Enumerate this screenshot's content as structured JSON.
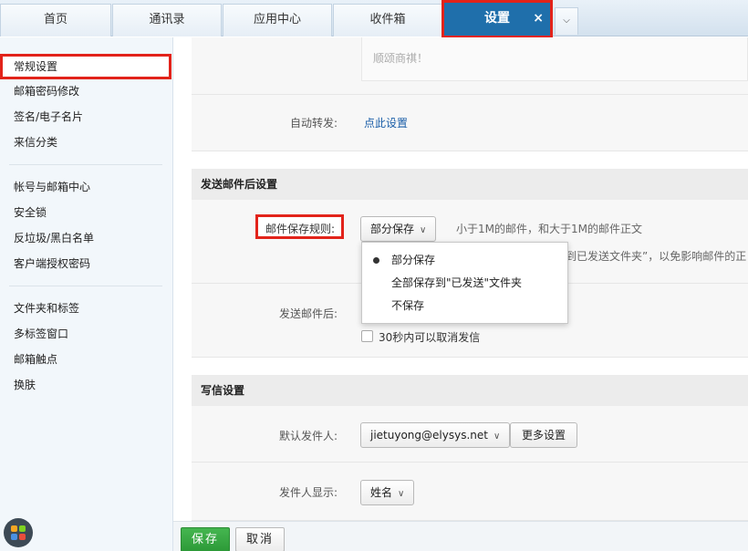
{
  "tabs": [
    {
      "label": "首页"
    },
    {
      "label": "通讯录"
    },
    {
      "label": "应用中心"
    },
    {
      "label": "收件箱"
    },
    {
      "label": "设置",
      "close": "×"
    }
  ],
  "tab_more_icon": "chevron-down-icon",
  "sidebar": {
    "groups": [
      [
        "常规设置",
        "邮箱密码修改",
        "签名/电子名片",
        "来信分类"
      ],
      [
        "帐号与邮箱中心",
        "安全锁",
        "反垃圾/黑白名单",
        "客户端授权密码"
      ],
      [
        "文件夹和标签",
        "多标签窗口",
        "邮箱触点",
        "换肤"
      ]
    ]
  },
  "signature_preview": "顺颂商祺！",
  "auto_forward": {
    "label": "自动转发:",
    "link": "点此设置"
  },
  "after_send": {
    "title": "发送邮件后设置",
    "save_rule_label": "邮件保存规则:",
    "save_rule_value": "部分保存",
    "save_rule_hint": "小于1M的邮件，和大于1M的邮件正文",
    "save_rule_hint2": "到已发送文件夹”，以免影响邮件的正",
    "dropdown_options": [
      "部分保存",
      "全部保存到\"已发送\"文件夹",
      "不保存"
    ],
    "after_send_label": "发送邮件后:",
    "undo_label": "30秒内可以取消发信"
  },
  "compose": {
    "title": "写信设置",
    "sender_label": "默认发件人:",
    "sender_value": "jietuyong@elysys.net",
    "more_settings": "更多设置",
    "display_label": "发件人显示:",
    "display_value": "姓名"
  },
  "bottom": {
    "save": "保存",
    "cancel": "取消"
  },
  "colors": {
    "accent": "#1f6fab",
    "highlight": "#e2231a",
    "save": "#3aa845"
  }
}
